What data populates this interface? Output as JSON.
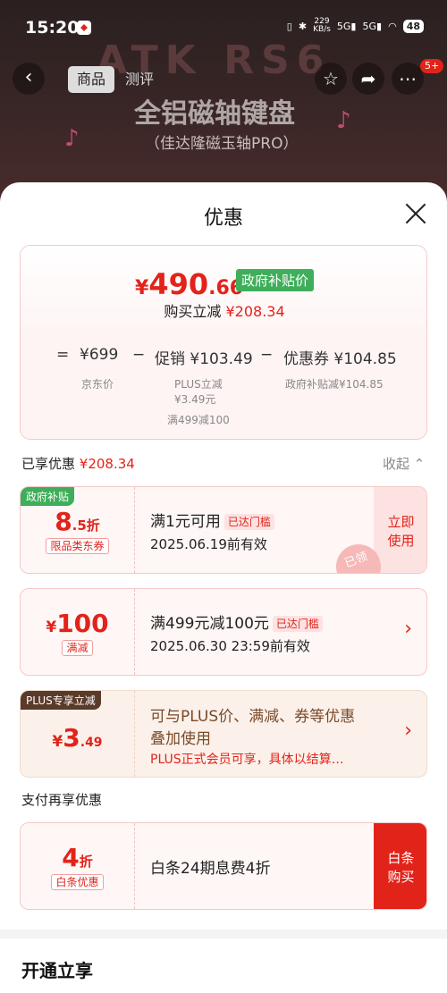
{
  "status": {
    "time": "15:20",
    "net_speed": "229",
    "net_unit": "KB/s",
    "sig1": "5G",
    "sig2": "5G",
    "battery": "48"
  },
  "hero": {
    "title": "ATK RS6",
    "subtitle": "全铝磁轴键盘",
    "caption": "（佳达隆磁玉轴PRO）"
  },
  "nav": {
    "back": "‹",
    "tab_goods": "商品",
    "tab_review": "测评",
    "more_badge": "5+"
  },
  "sheet": {
    "title": "优惠"
  },
  "price": {
    "symbol": "¥",
    "int": "490",
    "dec": ".66",
    "gov_tag": "政府补贴价",
    "buy_label": "购买立减",
    "buy_amount": "¥208.34",
    "eq": "=",
    "jd_price": "¥699",
    "minus1": "−",
    "promo_label": "促销",
    "promo_amount": "¥103.49",
    "minus2": "−",
    "coupon_label": "优惠券",
    "coupon_amount": "¥104.85",
    "jd_label": "京东价",
    "plus_label": "PLUS立减",
    "plus_amount": "¥3.49元",
    "full_reduce": "满499减100",
    "gov_reduce": "政府补贴减¥104.85"
  },
  "enjoyed": {
    "label": "已享优惠",
    "amount": "¥208.34",
    "collapse": "收起 ⌃"
  },
  "coupons": [
    {
      "tag": "政府补贴",
      "value_main": "8",
      "value_sub": ".5折",
      "pill": "限品类东券",
      "line1": "满1元可用",
      "reach": "已达门槛",
      "line2": "2025.06.19前有效",
      "action": "立即\n使用",
      "stamp": "已领"
    },
    {
      "sym": "¥",
      "value_main": "100",
      "pill": "满减",
      "line1": "满499元减100元",
      "reach": "已达门槛",
      "line2": "2025.06.30 23:59前有效",
      "chev": "›"
    },
    {
      "tag": "PLUS专享立减",
      "sym": "¥",
      "value_main": "3",
      "value_sub": ".49",
      "line1": "可与PLUS价、满减、券等优惠",
      "line1b": "叠加使用",
      "line2": "PLUS正式会员可享，具体以结算…",
      "chev": "›"
    }
  ],
  "pay": {
    "title": "支付再享优惠",
    "value_main": "4",
    "value_sub": "折",
    "pill": "白条优惠",
    "line1": "白条24期息费4折",
    "action": "白条\n购买"
  },
  "open": {
    "title": "开通立享"
  },
  "colors": {
    "accent": "#e2231a",
    "gov_green": "#3fae5a",
    "plus_brown": "#5a3a2a"
  }
}
